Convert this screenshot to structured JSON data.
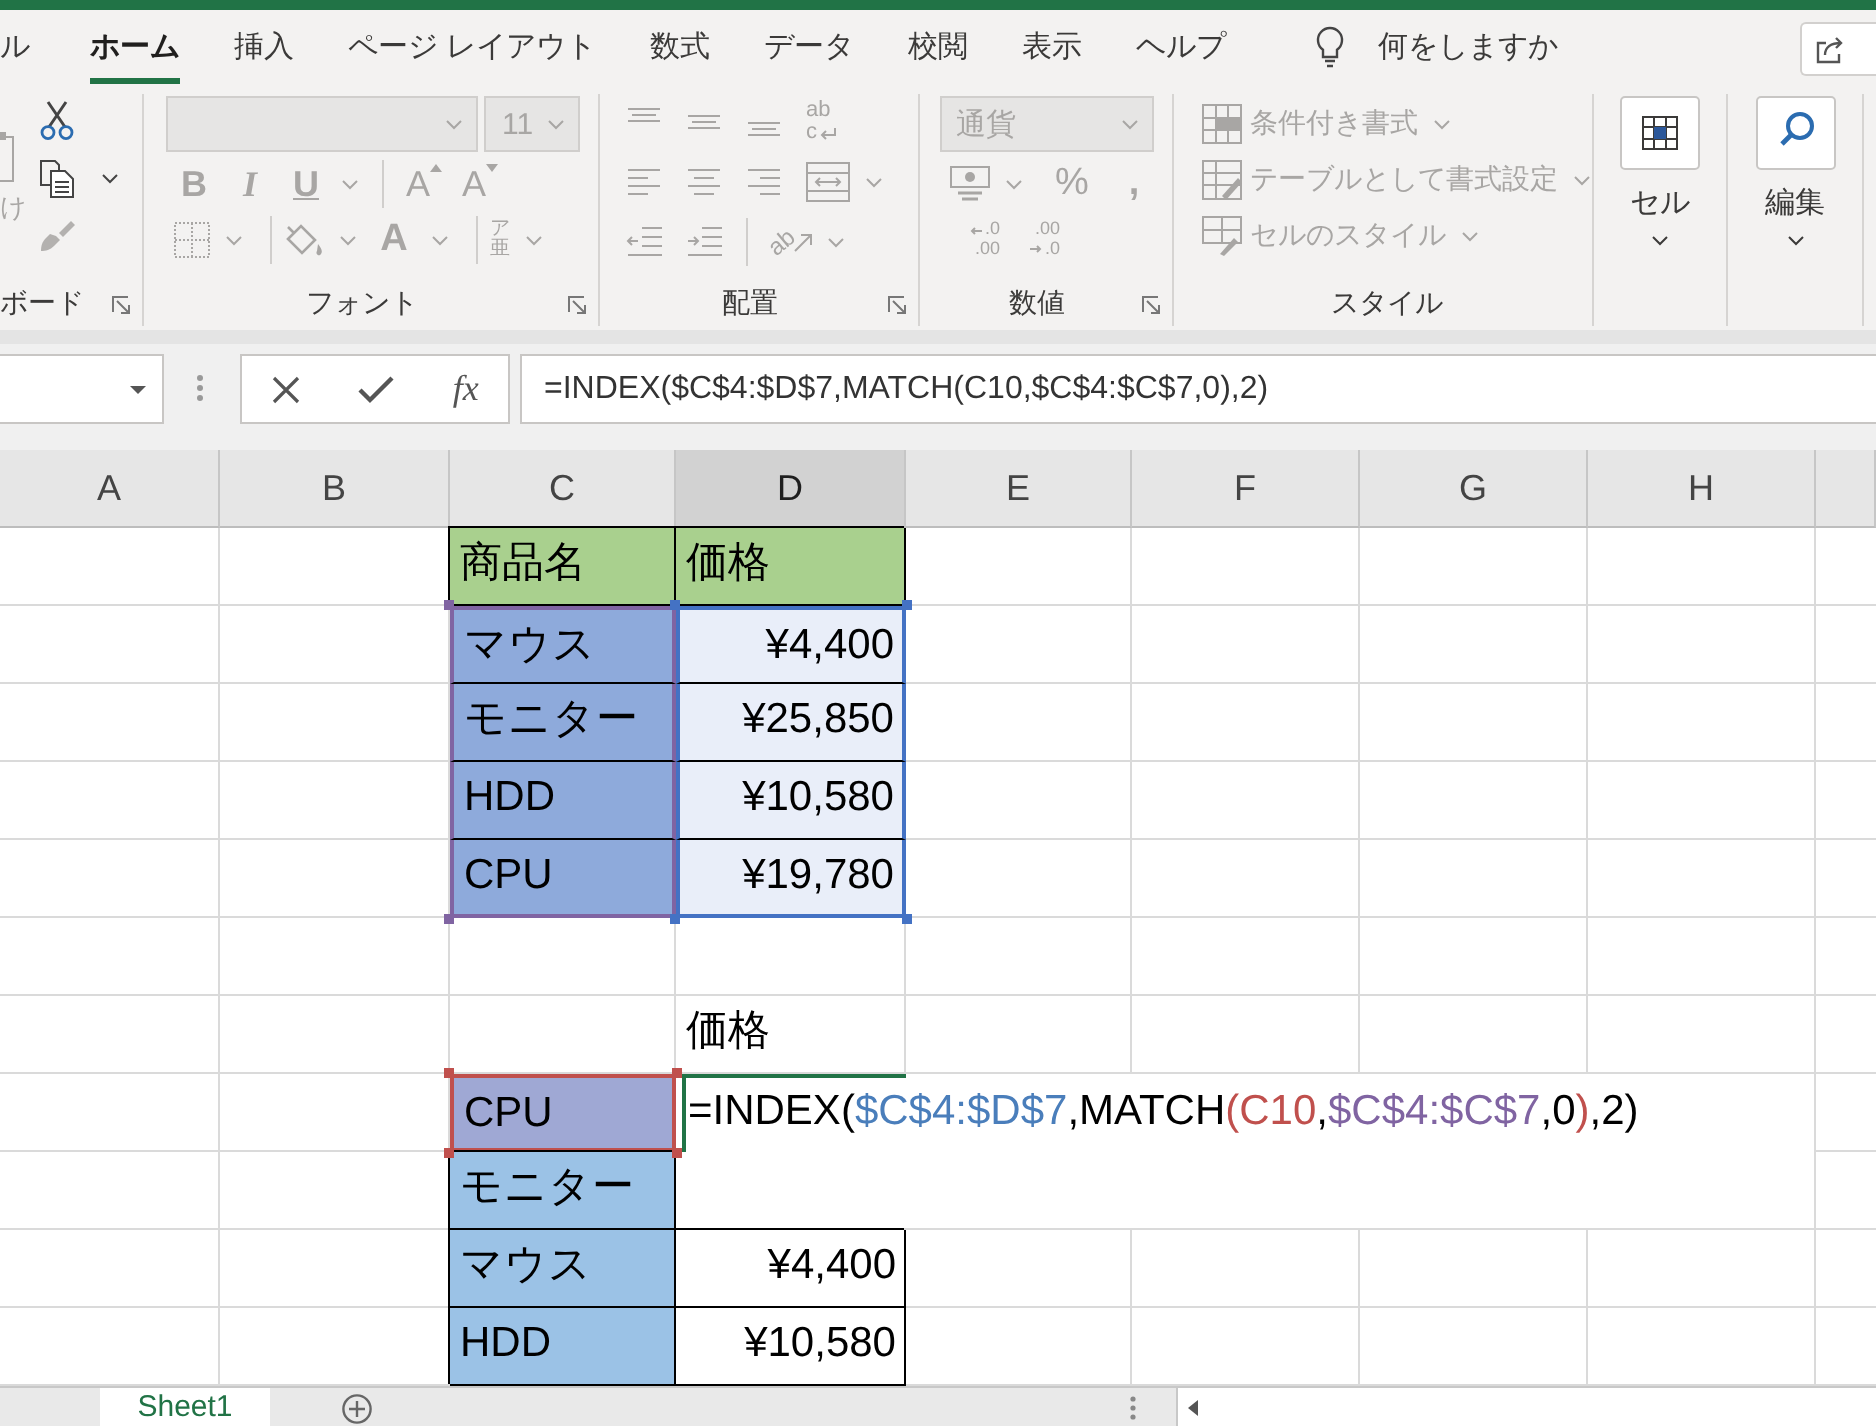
{
  "ribbon_tabs": [
    {
      "label": "ル",
      "selected": false
    },
    {
      "label": "ホーム",
      "selected": true
    },
    {
      "label": "挿入",
      "selected": false
    },
    {
      "label": "ページ レイアウト",
      "selected": false
    },
    {
      "label": "数式",
      "selected": false
    },
    {
      "label": "データ",
      "selected": false
    },
    {
      "label": "校閲",
      "selected": false
    },
    {
      "label": "表示",
      "selected": false
    },
    {
      "label": "ヘルプ",
      "selected": false
    }
  ],
  "tell_me": {
    "label": "何をしますか"
  },
  "ribbon_groups": [
    {
      "kind": "clipboard",
      "label": "ボード",
      "paste": {
        "label": "け",
        "disabled": true
      },
      "tools": [
        {
          "kind": "cut",
          "disabled": false
        },
        {
          "kind": "copy",
          "disabled": false
        },
        {
          "kind": "format_painter",
          "disabled": true
        }
      ]
    },
    {
      "kind": "font",
      "label": "フォント",
      "disabled": true,
      "font_size": "11",
      "style_buttons": [
        "B",
        "I",
        "U"
      ],
      "size_buttons": [
        "A",
        "A"
      ],
      "color_button": "A",
      "phonetic": [
        "ア",
        "亜"
      ]
    },
    {
      "kind": "alignment",
      "label": "配置",
      "disabled": true,
      "wrap_glyphs": [
        "ab",
        "c"
      ],
      "orientation_glyphs": "ab"
    },
    {
      "kind": "number",
      "label": "数値",
      "disabled": true,
      "format": "通貨",
      "percent": "%",
      "comma": ",",
      "decimal_buttons": [
        {
          "kind": "increase",
          "lines": [
            ".0",
            ".00"
          ]
        },
        {
          "kind": "decrease",
          "lines": [
            ".00",
            ".0"
          ]
        }
      ]
    },
    {
      "kind": "styles",
      "label": "スタイル",
      "disabled": true,
      "items": [
        "条件付き書式",
        "テーブルとして書式設定",
        "セルのスタイル"
      ]
    },
    {
      "kind": "cells",
      "label": "セル",
      "disabled": false
    },
    {
      "kind": "editing",
      "label": "編集",
      "disabled": false
    }
  ],
  "formula_bar": {
    "insert_function": "fx",
    "formula": "=INDEX($C$4:$D$7,MATCH(C10,$C$4:$C$7,0),2)"
  },
  "columns": [
    {
      "label": "A",
      "selected": false
    },
    {
      "label": "B",
      "selected": false
    },
    {
      "label": "C",
      "selected": false
    },
    {
      "label": "D",
      "selected": true
    },
    {
      "label": "E",
      "selected": false
    },
    {
      "label": "F",
      "selected": false
    },
    {
      "label": "G",
      "selected": false
    },
    {
      "label": "H",
      "selected": false
    }
  ],
  "rows": [
    [
      null,
      null,
      {
        "kind": "text",
        "text": "商品名",
        "color": "#a9d08e",
        "bordered": true,
        "selected": false
      },
      {
        "kind": "text",
        "text": "価格",
        "color": "#a9d08e",
        "bordered": true,
        "selected": false
      }
    ],
    [
      null,
      null,
      {
        "kind": "text",
        "text": "マウス",
        "color": "#8eaadb",
        "reference": {
          "color": "#8064a2"
        },
        "bordered": true,
        "selected": false
      },
      {
        "kind": "number",
        "text": "¥4,400",
        "color": "#e9eef9",
        "reference": {
          "color": "#4472c4"
        },
        "bordered": true,
        "selected": false
      }
    ],
    [
      null,
      null,
      {
        "kind": "text",
        "text": "モニター",
        "color": "#8eaadb",
        "reference": {
          "color": "#8064a2"
        },
        "bordered": true,
        "selected": false
      },
      {
        "kind": "number",
        "text": "¥25,850",
        "color": "#e9eef9",
        "reference": {
          "color": "#4472c4"
        },
        "bordered": true,
        "selected": false
      }
    ],
    [
      null,
      null,
      {
        "kind": "text",
        "text": "HDD",
        "color": "#8eaadb",
        "reference": {
          "color": "#8064a2"
        },
        "bordered": true,
        "selected": false
      },
      {
        "kind": "number",
        "text": "¥10,580",
        "color": "#e9eef9",
        "reference": {
          "color": "#4472c4"
        },
        "bordered": true,
        "selected": false
      }
    ],
    [
      null,
      null,
      {
        "kind": "text",
        "text": "CPU",
        "color": "#8eaadb",
        "reference": {
          "color": "#8064a2"
        },
        "selected": false
      },
      {
        "kind": "number",
        "text": "¥19,780",
        "color": "#e9eef9",
        "reference": {
          "color": "#4472c4"
        },
        "selected": false
      }
    ],
    [],
    [
      null,
      null,
      null,
      {
        "kind": "text",
        "text": "価格",
        "bordered": false,
        "selected": false
      }
    ],
    [
      null,
      null,
      {
        "kind": "text",
        "text": "CPU",
        "color": "#9fa8d4",
        "reference": {
          "color": "#c0504d"
        },
        "selected": false
      },
      {
        "kind": "formula",
        "selected": true,
        "segments": [
          {
            "text": "=INDEX(",
            "color": "#000000"
          },
          {
            "text": "$C$4:$D$7",
            "color": "#4a7ebb"
          },
          {
            "text": ",MATCH",
            "color": "#000000"
          },
          {
            "text": "(C10",
            "color": "#c0504d"
          },
          {
            "text": ",",
            "color": "#000000"
          },
          {
            "text": "$C$4:$C$7",
            "color": "#8064a2"
          },
          {
            "text": ",0",
            "color": "#000000"
          },
          {
            "text": ")",
            "color": "#c0504d"
          },
          {
            "text": ",2)",
            "color": "#000000"
          }
        ]
      }
    ],
    [
      null,
      null,
      {
        "kind": "text",
        "text": "モニター",
        "color": "#9bc2e6",
        "bordered": true,
        "selected": false
      }
    ],
    [
      null,
      null,
      {
        "kind": "text",
        "text": "マウス",
        "color": "#9bc2e6",
        "bordered": true,
        "selected": false
      },
      {
        "kind": "number",
        "text": "¥4,400",
        "bordered": true,
        "selected": false
      }
    ],
    [
      null,
      null,
      {
        "kind": "text",
        "text": "HDD",
        "color": "#9bc2e6",
        "bordered": true,
        "selected": false
      },
      {
        "kind": "number",
        "text": "¥10,580",
        "bordered": true,
        "selected": false
      }
    ]
  ],
  "sheet_tabs": [
    {
      "label": "Sheet1",
      "selected": true
    }
  ]
}
